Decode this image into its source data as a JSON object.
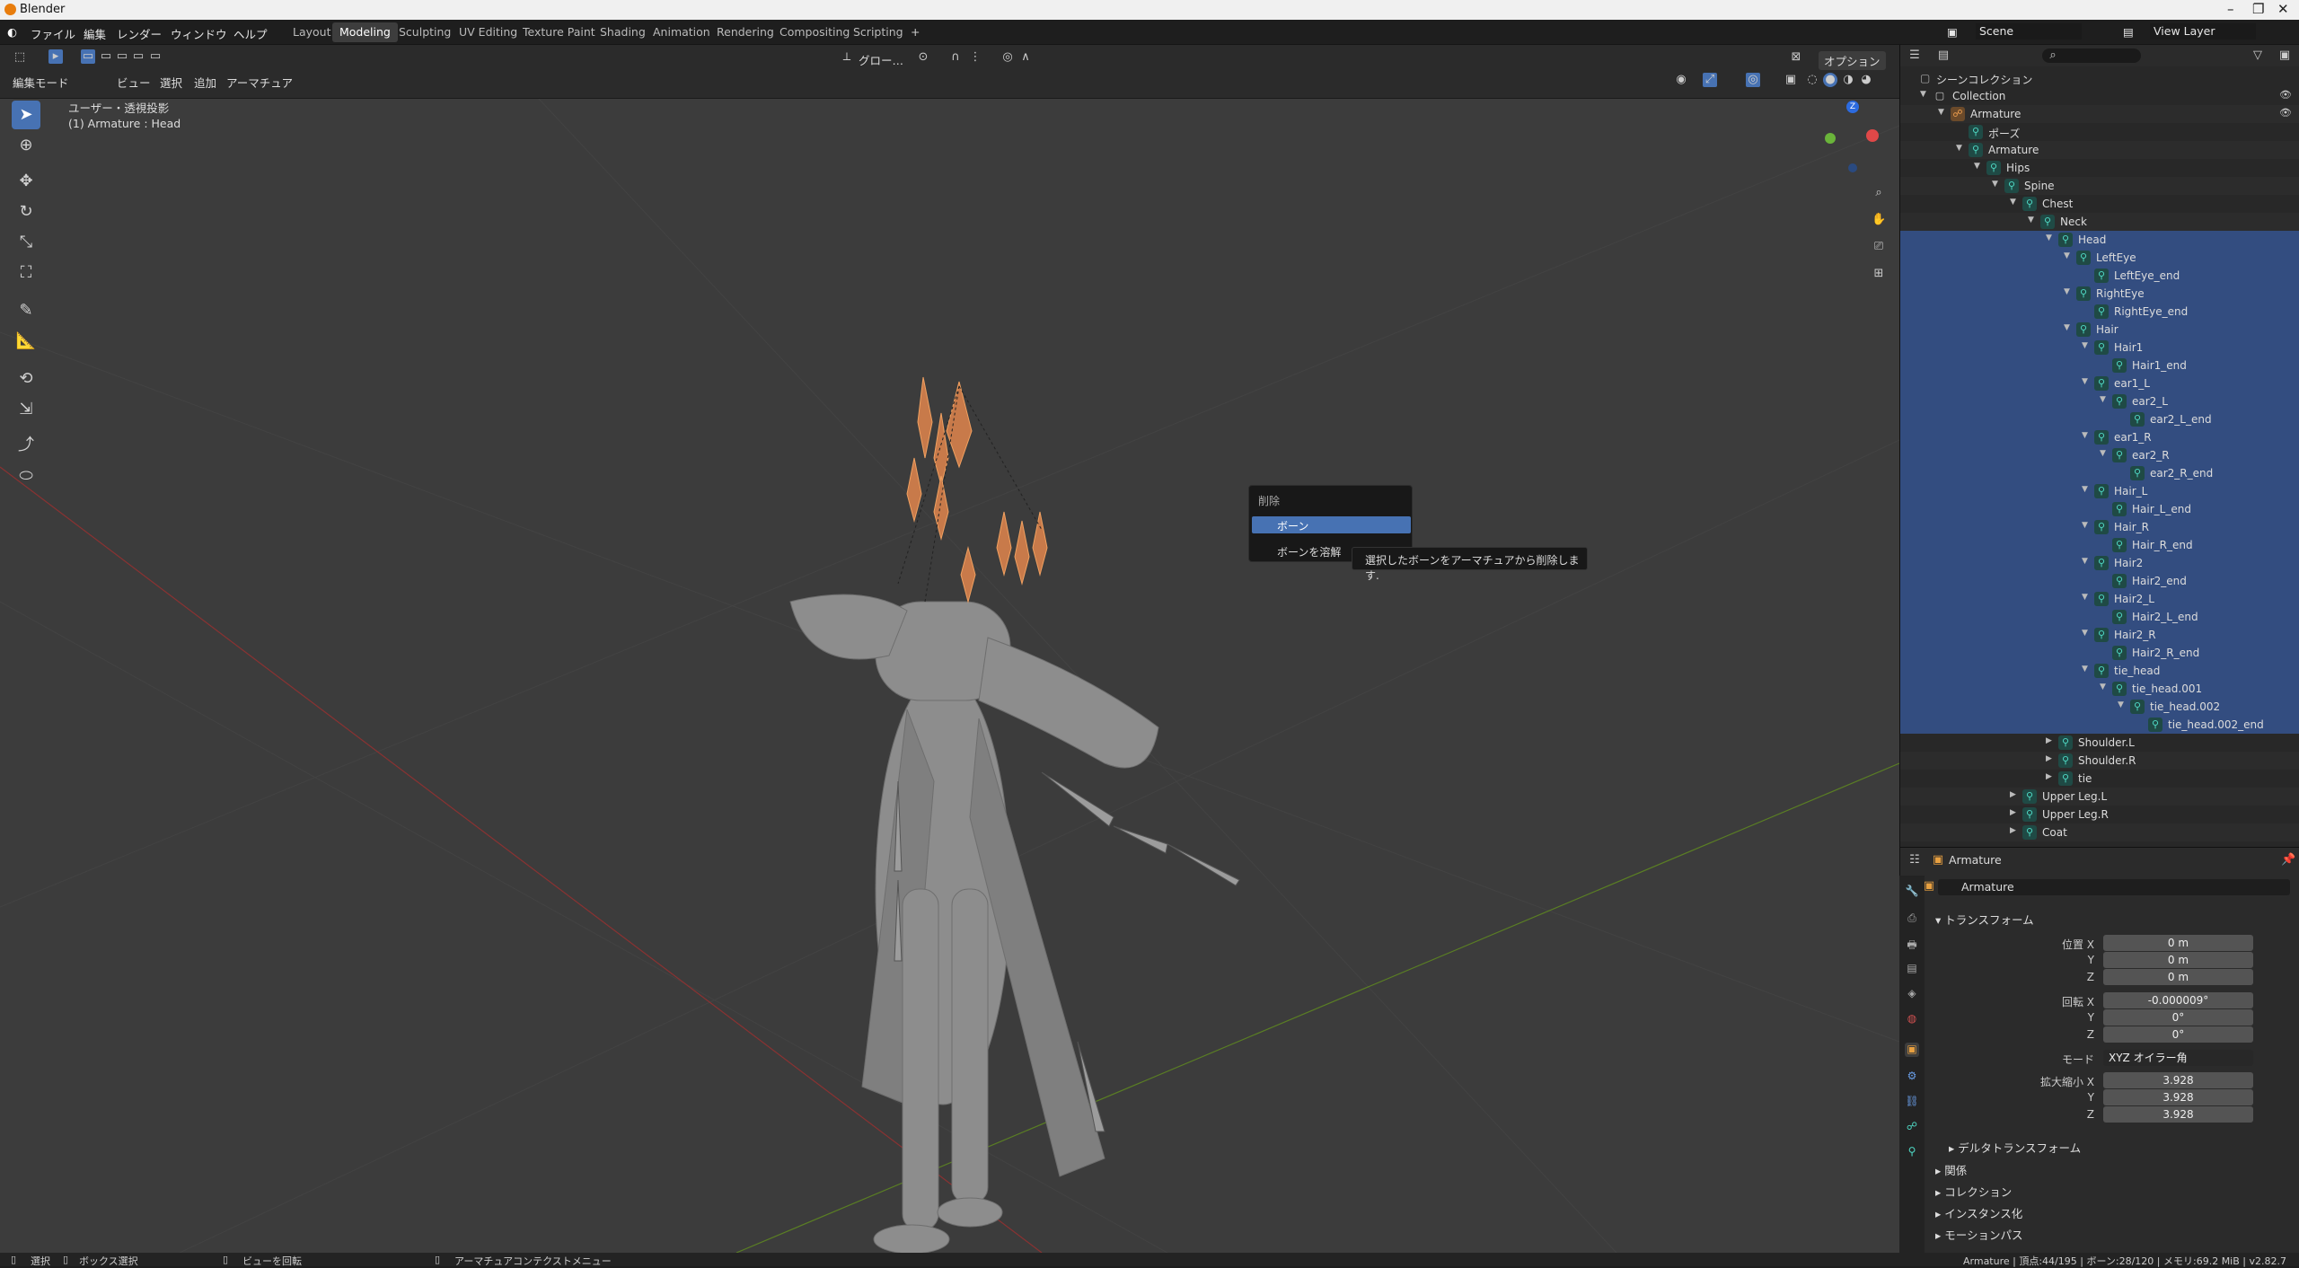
{
  "app_title": "Blender",
  "menus": [
    "ファイル",
    "編集",
    "レンダー",
    "ウィンドウ",
    "ヘルプ"
  ],
  "workspaces": [
    "Layout",
    "Modeling",
    "Sculpting",
    "UV Editing",
    "Texture Paint",
    "Shading",
    "Animation",
    "Rendering",
    "Compositing",
    "Scripting"
  ],
  "active_workspace": "Modeling",
  "scene": "Scene",
  "view_layer": "View Layer",
  "viewport": {
    "mode": "編集モード",
    "header_menus": [
      "ビュー",
      "選択",
      "追加",
      "アーマチュア"
    ],
    "transform_orientation": "グロー…",
    "options": "オプション",
    "view_label": "ユーザー・透視投影",
    "object_label": "(1) Armature : Head"
  },
  "context_menu": {
    "title": "削除",
    "items": [
      "ボーン",
      "ボーンを溶解"
    ],
    "selected": "ボーン"
  },
  "tooltip": "選択したボーンをアーマチュアから削除します.",
  "outliner": {
    "root": "シーンコレクション",
    "rows": [
      {
        "label": "Collection",
        "depth": 1
      },
      {
        "label": "Armature",
        "depth": 2
      },
      {
        "label": "ポーズ",
        "depth": 3
      },
      {
        "label": "Armature",
        "depth": 3
      },
      {
        "label": "Hips",
        "depth": 4
      },
      {
        "label": "Spine",
        "depth": 5
      },
      {
        "label": "Chest",
        "depth": 6
      },
      {
        "label": "Neck",
        "depth": 7
      },
      {
        "label": "Head",
        "depth": 8
      },
      {
        "label": "LeftEye",
        "depth": 9
      },
      {
        "label": "LeftEye_end",
        "depth": 10
      },
      {
        "label": "RightEye",
        "depth": 9
      },
      {
        "label": "RightEye_end",
        "depth": 10
      },
      {
        "label": "Hair",
        "depth": 9
      },
      {
        "label": "Hair1",
        "depth": 10
      },
      {
        "label": "Hair1_end",
        "depth": 11
      },
      {
        "label": "ear1_L",
        "depth": 10
      },
      {
        "label": "ear2_L",
        "depth": 11
      },
      {
        "label": "ear2_L_end",
        "depth": 12
      },
      {
        "label": "ear1_R",
        "depth": 10
      },
      {
        "label": "ear2_R",
        "depth": 11
      },
      {
        "label": "ear2_R_end",
        "depth": 12
      },
      {
        "label": "Hair_L",
        "depth": 10
      },
      {
        "label": "Hair_L_end",
        "depth": 11
      },
      {
        "label": "Hair_R",
        "depth": 10
      },
      {
        "label": "Hair_R_end",
        "depth": 11
      },
      {
        "label": "Hair2",
        "depth": 10
      },
      {
        "label": "Hair2_end",
        "depth": 11
      },
      {
        "label": "Hair2_L",
        "depth": 10
      },
      {
        "label": "Hair2_L_end",
        "depth": 11
      },
      {
        "label": "Hair2_R",
        "depth": 10
      },
      {
        "label": "Hair2_R_end",
        "depth": 11
      },
      {
        "label": "tie_head",
        "depth": 10
      },
      {
        "label": "tie_head.001",
        "depth": 11
      },
      {
        "label": "tie_head.002",
        "depth": 12
      },
      {
        "label": "tie_head.002_end",
        "depth": 13
      },
      {
        "label": "Shoulder.L",
        "depth": 8
      },
      {
        "label": "Shoulder.R",
        "depth": 8
      },
      {
        "label": "tie",
        "depth": 8
      },
      {
        "label": "Upper Leg.L",
        "depth": 6
      },
      {
        "label": "Upper Leg.R",
        "depth": 6
      },
      {
        "label": "Coat",
        "depth": 6
      }
    ]
  },
  "properties": {
    "header": "Armature",
    "object_name": "Armature",
    "transform_title": "トランスフォーム",
    "location": {
      "label": "位置 X",
      "x": "0 m",
      "y": "0 m",
      "z": "0 m"
    },
    "rotation": {
      "label": "回転 X",
      "x": "-0.000009°",
      "y": "0°",
      "z": "0°"
    },
    "mode": {
      "label": "モード",
      "value": "XYZ オイラー角"
    },
    "scale": {
      "label": "拡大縮小 X",
      "x": "3.928",
      "y": "3.928",
      "z": "3.928"
    },
    "axis_y": "Y",
    "axis_z": "Z",
    "sections": [
      "デルタトランスフォーム",
      "関係",
      "コレクション",
      "インスタンス化",
      "モーションパス"
    ]
  },
  "statusbar": {
    "select": "選択",
    "box_select": "ボックス選択",
    "rotate_view": "ビューを回転",
    "context_menu": "アーマチュアコンテクストメニュー",
    "stats": "Armature | 頂点:44/195 | ボーン:28/120 | メモリ:69.2 MiB | v2.82.7"
  }
}
